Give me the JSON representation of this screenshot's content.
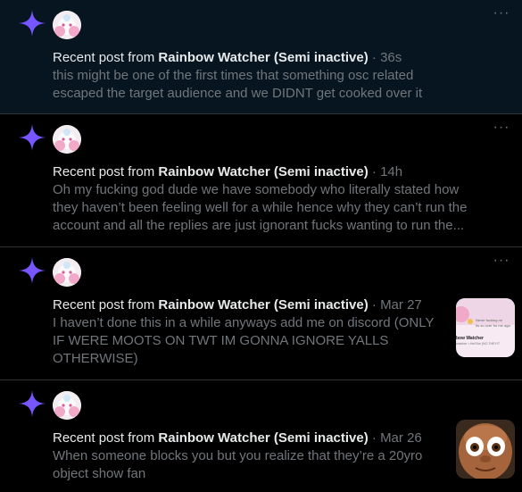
{
  "accent_color": "#7856ff",
  "notifications": [
    {
      "prefix": "Recent post from ",
      "author": "Rainbow Watcher (Semi inactive)",
      "separator": "·",
      "time": "36s",
      "lines": [
        "this might be one of the first times that something osc related",
        "escaped the target audience and we DIDNT get cooked over it"
      ],
      "unread": true
    },
    {
      "prefix": "Recent post from ",
      "author": "Rainbow Watcher (Semi inactive)",
      "separator": "·",
      "time": "14h",
      "lines": [
        "Oh my fucking god dude we have somebody who literally stated how",
        "they haven’t been feeling well for a while hence why they can’t run the",
        "account and all the replies are just ignorant fucks wanting to run the..."
      ]
    },
    {
      "prefix": "Recent post from ",
      "author": "Rainbow Watcher (Semi inactive)",
      "separator": "·",
      "time": "Mar 27",
      "lines": [
        "I haven’t done this in a while anyways add me on discord (ONLY",
        "IF WERE MOOTS ON TWT IM GONNA IGNORE YALLS",
        "OTHERWISE)"
      ],
      "thumbnail": {
        "type": "screenshot",
        "lines": [
          "Never fucking mi",
          "Its so over for me aga",
          "bow Watcher",
          "watcher • He/She (NO THEY/T"
        ]
      }
    },
    {
      "prefix": "Recent post from ",
      "author": "Rainbow Watcher (Semi inactive)",
      "separator": "·",
      "time": "Mar 26",
      "lines": [
        "When someone blocks you but you realize that they’re a 20yro",
        "object show fan"
      ],
      "thumbnail": {
        "type": "face-photo"
      }
    }
  ]
}
